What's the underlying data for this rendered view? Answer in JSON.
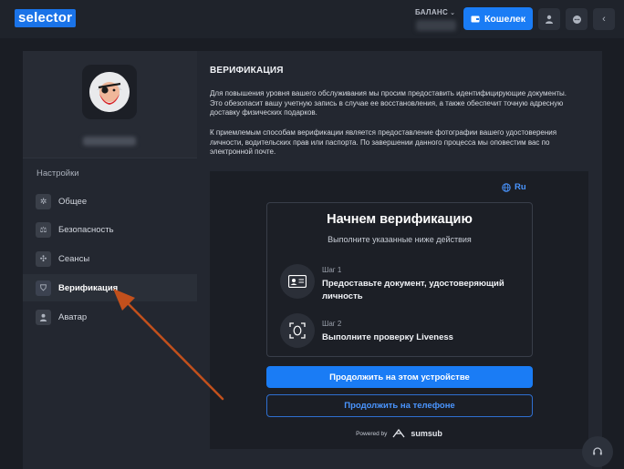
{
  "header": {
    "logo": "selector",
    "balance_label": "БАЛАНС",
    "wallet_button": "Кошелек"
  },
  "sidebar": {
    "settings_title": "Настройки",
    "items": [
      {
        "label": "Общее",
        "icon": "gear-icon"
      },
      {
        "label": "Безопасность",
        "icon": "scales-icon"
      },
      {
        "label": "Сеансы",
        "icon": "network-icon"
      },
      {
        "label": "Верификация",
        "icon": "shield-icon",
        "active": true
      },
      {
        "label": "Аватар",
        "icon": "user-icon"
      }
    ]
  },
  "main": {
    "title": "ВЕРИФИКАЦИЯ",
    "paragraph1": "Для повышения уровня вашего обслуживания мы просим предоставить идентифицирующие документы. Это обезопасит вашу учетную запись в случае ее восстановления, а также обеспечит точную адресную доставку физических подарков.",
    "paragraph2": "К приемлемым способам верификации является предоставление фотографии вашего удостоверения личности, водительских прав или паспорта. По завершении данного процесса мы оповестим вас по электронной почте."
  },
  "widget": {
    "language": "Ru",
    "card_title": "Начнем верификацию",
    "card_subtitle": "Выполните указанные ниже действия",
    "steps": [
      {
        "number": "Шаг 1",
        "text": "Предоставьте документ, удостоверяющий личность"
      },
      {
        "number": "Шаг 2",
        "text": "Выполните проверку Liveness"
      }
    ],
    "primary_button": "Продолжить на этом устройстве",
    "secondary_button": "Продолжить на телефоне",
    "powered_by": "Powered by",
    "brand": "sumsub"
  },
  "colors": {
    "accent": "#1a7cf5",
    "background": "#1a1d24",
    "panel": "#232730",
    "arrow": "#c2501c"
  }
}
